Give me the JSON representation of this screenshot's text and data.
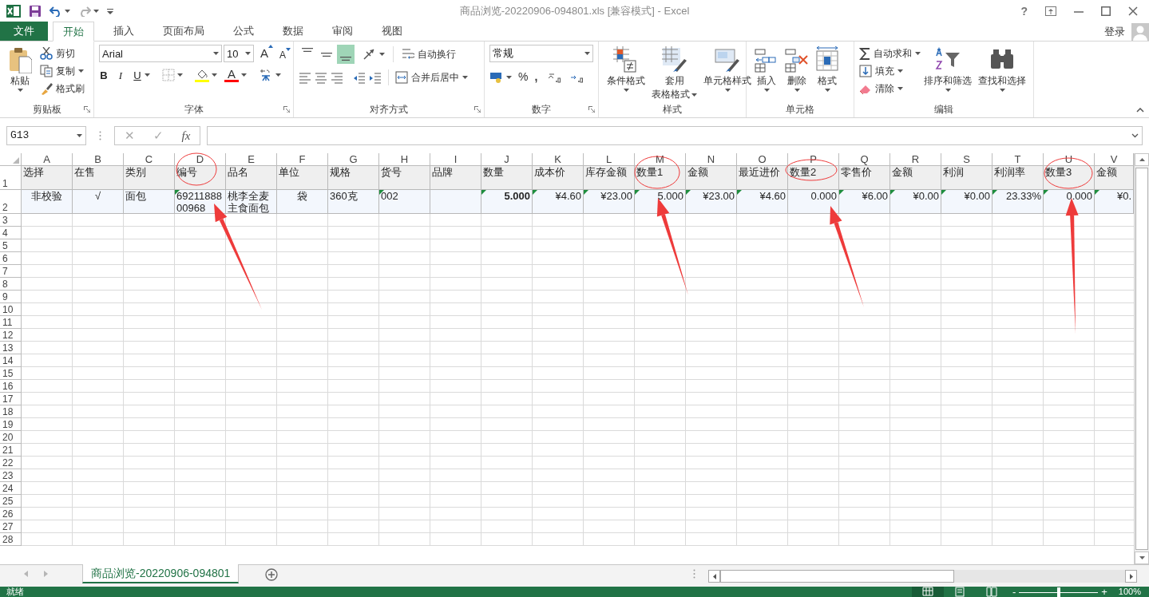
{
  "window": {
    "title": "商品浏览-20220906-094801.xls  [兼容模式] - Excel",
    "help": "?"
  },
  "tabs": [
    {
      "label": "文件",
      "kind": "file",
      "selected": false
    },
    {
      "label": "开始",
      "kind": "tab",
      "selected": true
    },
    {
      "label": "插入",
      "kind": "tab",
      "selected": false
    },
    {
      "label": "页面布局",
      "kind": "tab",
      "selected": false
    },
    {
      "label": "公式",
      "kind": "tab",
      "selected": false
    },
    {
      "label": "数据",
      "kind": "tab",
      "selected": false
    },
    {
      "label": "审阅",
      "kind": "tab",
      "selected": false
    },
    {
      "label": "视图",
      "kind": "tab",
      "selected": false
    }
  ],
  "account": {
    "login": "登录"
  },
  "ribbon": {
    "groups": [
      {
        "kind": "clipboard",
        "label": "剪贴板",
        "paste": "粘贴",
        "cut": "剪切",
        "copy": "复制",
        "format_painter": "格式刷"
      },
      {
        "kind": "font",
        "label": "字体",
        "font_name": "Arial",
        "font_size": "10",
        "grow": "A",
        "shrink": "A",
        "bold": "B",
        "italic": "I",
        "underline": "U",
        "font_color": "A"
      },
      {
        "kind": "alignment",
        "label": "对齐方式",
        "vertical_align": [
          {
            "selected": false
          },
          {
            "selected": false
          },
          {
            "selected": true
          }
        ],
        "wrap_text": "自动换行",
        "merge_center": "合并后居中"
      },
      {
        "kind": "number",
        "label": "数字",
        "format": "常规",
        "percent": "%",
        "comma": ","
      },
      {
        "kind": "styles",
        "label": "样式",
        "conditional": "条件格式",
        "table_format": [
          "套用",
          "表格格式"
        ],
        "cell_styles": "单元格样式"
      },
      {
        "kind": "cells",
        "label": "单元格",
        "insert": "插入",
        "delete": "删除",
        "format": "格式"
      },
      {
        "kind": "editing",
        "label": "编辑",
        "autosum": "自动求和",
        "fill": "填充",
        "clear": "清除",
        "sort_filter": "排序和筛选",
        "find_select": "查找和选择"
      }
    ]
  },
  "formula_bar": {
    "name_box": "G13",
    "cancel": "✕",
    "enter": "✓",
    "function": "fx"
  },
  "sheet": {
    "columns": [
      "A",
      "B",
      "C",
      "D",
      "E",
      "F",
      "G",
      "H",
      "I",
      "J",
      "K",
      "L",
      "M",
      "N",
      "O",
      "P",
      "Q",
      "R",
      "S",
      "T",
      "U",
      "V"
    ],
    "row_numbers": [
      "1",
      "2",
      "3",
      "4",
      "5",
      "6",
      "7",
      "8",
      "9",
      "10",
      "11",
      "12",
      "13",
      "14",
      "15",
      "16",
      "17",
      "18",
      "19",
      "20",
      "21",
      "22",
      "23",
      "24",
      "25",
      "26",
      "27",
      "28"
    ],
    "rows": [
      [
        {
          "text": "选择"
        },
        {
          "text": "在售"
        },
        {
          "text": "类别"
        },
        {
          "text": "编号"
        },
        {
          "text": "品名"
        },
        {
          "text": "单位"
        },
        {
          "text": "规格"
        },
        {
          "text": "货号"
        },
        {
          "text": "品牌"
        },
        {
          "text": "数量"
        },
        {
          "text": "成本价"
        },
        {
          "text": "库存金额"
        },
        {
          "text": "数量1"
        },
        {
          "text": "金额"
        },
        {
          "text": "最近进价"
        },
        {
          "text": "数量2"
        },
        {
          "text": "零售价"
        },
        {
          "text": "金额"
        },
        {
          "text": "利润"
        },
        {
          "text": "利润率"
        },
        {
          "text": "数量3"
        },
        {
          "text": "金额"
        }
      ],
      [
        {
          "text": "非校验",
          "kind": "centered",
          "flag": false
        },
        {
          "text": "√",
          "kind": "centered",
          "flag": false
        },
        {
          "text": "面包",
          "kind": "text",
          "flag": false
        },
        {
          "text": "6921188800968",
          "kind": "text",
          "flag": true
        },
        {
          "text": "桃李全麦主食面包",
          "kind": "text",
          "flag": false
        },
        {
          "text": "袋",
          "kind": "centered",
          "flag": false
        },
        {
          "text": "360克",
          "kind": "text",
          "flag": false
        },
        {
          "text": "002",
          "kind": "text",
          "flag": true
        },
        {
          "kind": "text",
          "flag": false
        },
        {
          "text": "5.000",
          "kind": "number",
          "flag": true,
          "bold": true
        },
        {
          "text": "¥4.60",
          "kind": "number",
          "flag": true
        },
        {
          "text": "¥23.00",
          "kind": "number",
          "flag": true
        },
        {
          "text": "5.000",
          "kind": "number",
          "flag": true
        },
        {
          "text": "¥23.00",
          "kind": "number",
          "flag": true
        },
        {
          "text": "¥4.60",
          "kind": "number",
          "flag": true
        },
        {
          "text": "0.000",
          "kind": "number",
          "flag": false
        },
        {
          "text": "¥6.00",
          "kind": "number",
          "flag": true
        },
        {
          "text": "¥0.00",
          "kind": "number",
          "flag": true
        },
        {
          "text": "¥0.00",
          "kind": "number",
          "flag": true
        },
        {
          "text": "23.33%",
          "kind": "number",
          "flag": true
        },
        {
          "text": "0.000",
          "kind": "number",
          "flag": true
        },
        {
          "text": "¥0.",
          "kind": "number",
          "flag": true
        }
      ]
    ]
  },
  "sheet_tabs": [
    {
      "label": "商品浏览-20220906-094801",
      "selected": true
    }
  ],
  "status_bar": {
    "text": "就绪",
    "views": [
      {
        "selected": true
      },
      {
        "selected": false
      },
      {
        "selected": false
      }
    ],
    "zoom_minus": "-",
    "zoom_slider": {
      "level": 0.5
    },
    "zoom_plus": "+",
    "zoom": "100%"
  }
}
